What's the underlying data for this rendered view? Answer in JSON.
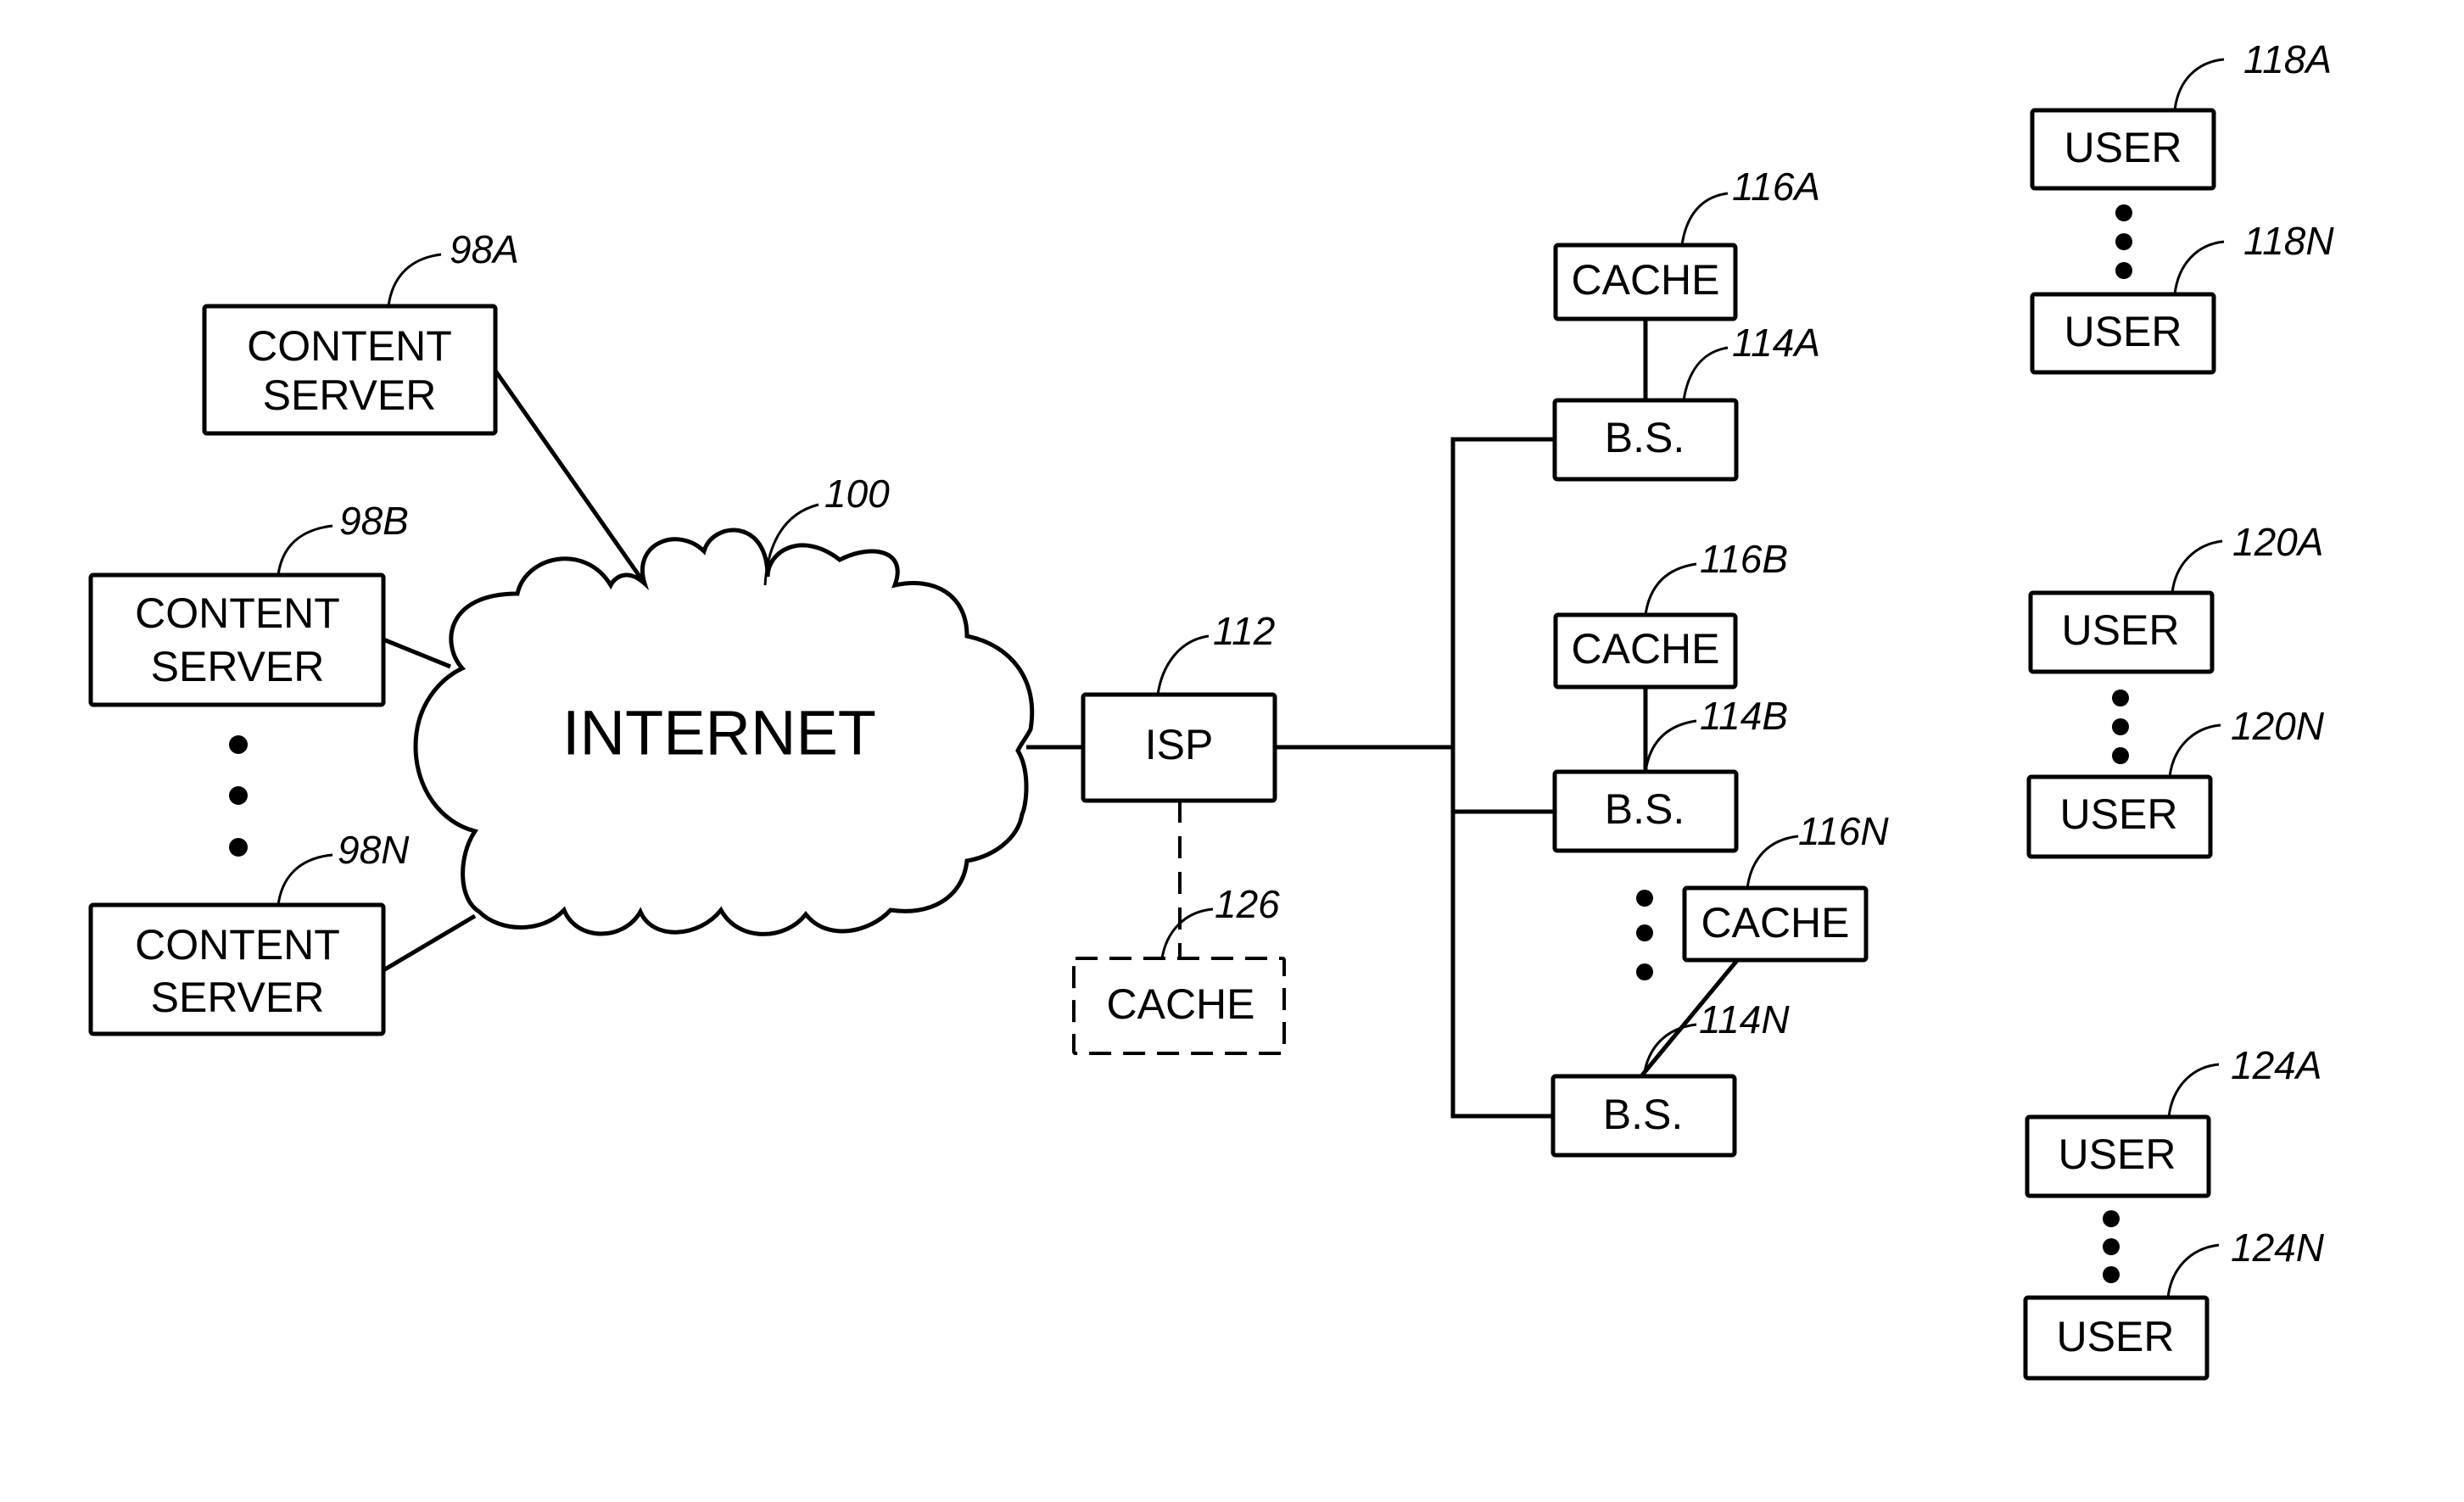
{
  "diagram": {
    "cloud": {
      "label": "INTERNET",
      "ref": "100"
    },
    "content_servers": [
      {
        "label_line1": "CONTENT",
        "label_line2": "SERVER",
        "ref": "98A"
      },
      {
        "label_line1": "CONTENT",
        "label_line2": "SERVER",
        "ref": "98B"
      },
      {
        "label_line1": "CONTENT",
        "label_line2": "SERVER",
        "ref": "98N"
      }
    ],
    "isp": {
      "label": "ISP",
      "ref": "112"
    },
    "isp_cache": {
      "label": "CACHE",
      "ref": "126",
      "style": "dashed (optional)"
    },
    "base_stations": [
      {
        "label": "B.S.",
        "ref": "114A",
        "cache": {
          "label": "CACHE",
          "ref": "116A"
        }
      },
      {
        "label": "B.S.",
        "ref": "114B",
        "cache": {
          "label": "CACHE",
          "ref": "116B"
        }
      },
      {
        "label": "B.S.",
        "ref": "114N",
        "cache": {
          "label": "CACHE",
          "ref": "116N"
        }
      }
    ],
    "user_groups": [
      {
        "users": [
          {
            "label": "USER",
            "ref": "118A"
          },
          {
            "label": "USER",
            "ref": "118N"
          }
        ]
      },
      {
        "users": [
          {
            "label": "USER",
            "ref": "120A"
          },
          {
            "label": "USER",
            "ref": "120N"
          }
        ]
      },
      {
        "users": [
          {
            "label": "USER",
            "ref": "124A"
          },
          {
            "label": "USER",
            "ref": "124N"
          }
        ]
      }
    ],
    "ellipsis_icon": "vertical-ellipsis"
  }
}
